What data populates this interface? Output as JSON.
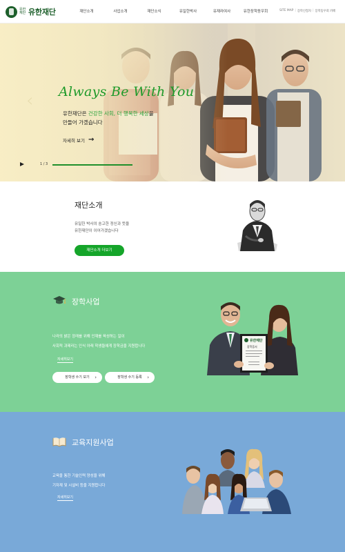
{
  "header": {
    "logo_small": "유한 재단",
    "logo_text": "유한재단",
    "nav": [
      "재단소개",
      "사업소개",
      "재단소식",
      "유일한박사",
      "유재라여사",
      "유한장학동우회"
    ],
    "util": [
      "SITE MAP",
      "장학신청자",
      "장학동우회 카페"
    ]
  },
  "hero": {
    "title": "Always Be With You",
    "copy_line1_pre": "유한재단은 ",
    "copy_line1_highlight": "건강한 사회, 더 행복한 세상",
    "copy_line1_post": "을",
    "copy_line2": "만들어 가겠습니다",
    "more_label": "자세히 보기",
    "more_arrow": "→",
    "prev_icon": "‹",
    "slide_counter": "1 / 3",
    "progress": 0.33
  },
  "intro": {
    "title": "재단소개",
    "text_line1": "유일한 박사의 숭고한 정신과 뜻을",
    "text_line2": "유한재단이 이어가겠습니다",
    "button": "재단소개 더보기"
  },
  "scholarship": {
    "title": "장학사업",
    "text_line1": "나라의 밝은 장래를 위해 인재를 육성하는 일이",
    "text_line2": "사회적 과제라는 인식 아래 학생들에게 장학금을 지원합니다",
    "link": "자세히보기",
    "buttons": [
      "장학생 수기 보기",
      "장학생 수기 등록"
    ],
    "button_chevron": "›",
    "certificate_heading": "유한재단",
    "certificate_sub": "장학증서"
  },
  "education": {
    "title": "교육지원사업",
    "text_line1": "교육을 통한 기술인력 양성을 위해",
    "text_line2": "기자재 및 시설비 등을 지원합니다",
    "link": "자세히보기"
  },
  "colors": {
    "brand_green": "#1d5f2b",
    "accent_green": "#15a52a",
    "scholarship_bg": "#7dd196",
    "education_bg": "#79a9d8"
  },
  "icons": [
    "play-icon",
    "arrow-right-icon",
    "chevron-left-icon",
    "graduation-cap-icon",
    "open-book-icon",
    "chevron-right-icon"
  ]
}
